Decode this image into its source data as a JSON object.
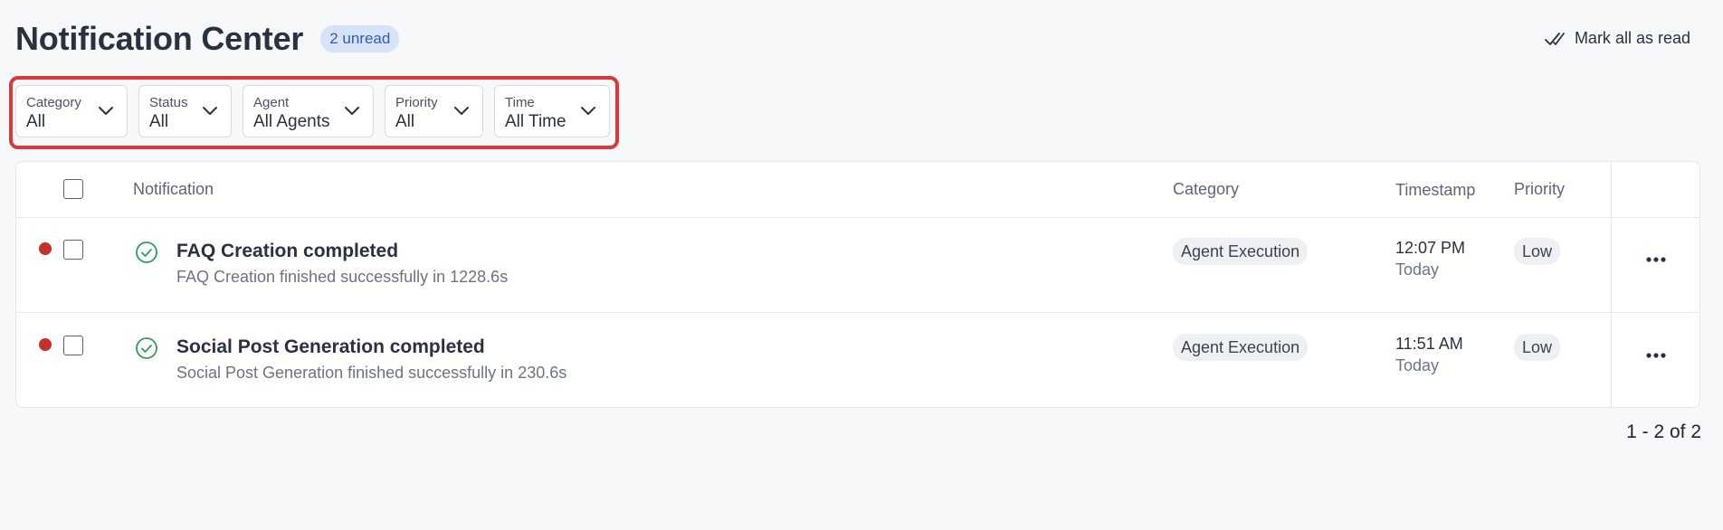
{
  "header": {
    "title": "Notification Center",
    "unread_badge": "2 unread",
    "mark_all_label": "Mark all as read"
  },
  "filters": [
    {
      "label": "Category",
      "value": "All"
    },
    {
      "label": "Status",
      "value": "All"
    },
    {
      "label": "Agent",
      "value": "All Agents"
    },
    {
      "label": "Priority",
      "value": "All"
    },
    {
      "label": "Time",
      "value": "All Time"
    }
  ],
  "table": {
    "columns": {
      "notification": "Notification",
      "category": "Category",
      "timestamp": "Timestamp",
      "priority": "Priority"
    },
    "rows": [
      {
        "unread": true,
        "status_icon": "check-circle-icon",
        "title": "FAQ Creation completed",
        "description": "FAQ Creation finished successfully in 1228.6s",
        "category": "Agent Execution",
        "time": "12:07 PM",
        "day": "Today",
        "priority": "Low"
      },
      {
        "unread": true,
        "status_icon": "check-circle-icon",
        "title": "Social Post Generation completed",
        "description": "Social Post Generation finished successfully in 230.6s",
        "category": "Agent Execution",
        "time": "11:51 AM",
        "day": "Today",
        "priority": "Low"
      }
    ]
  },
  "pagination": {
    "label": "1 - 2 of 2"
  },
  "colors": {
    "unread_dot": "#c5302c",
    "success_icon": "#2e9e5b",
    "badge_bg": "#d6e3f8",
    "highlight_outline": "#d9393b"
  }
}
